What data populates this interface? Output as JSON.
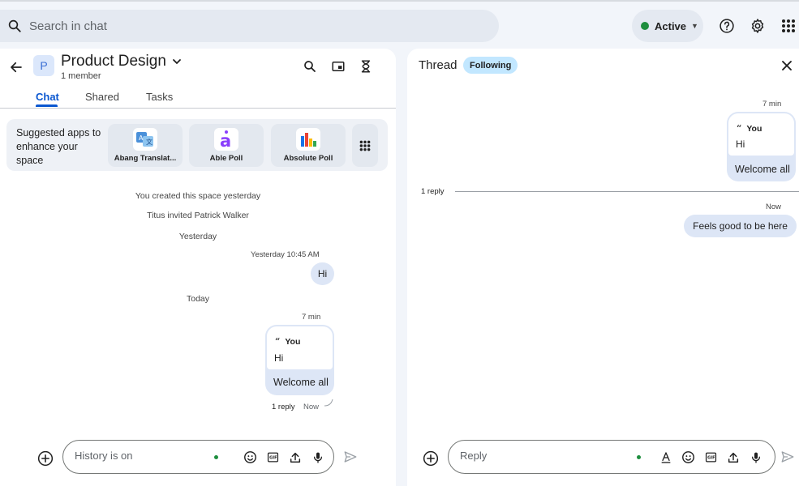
{
  "topbar": {
    "search_placeholder": "Search in chat",
    "status_label": "Active",
    "status_color": "#1e8e3e",
    "icons": [
      "search-icon",
      "help-icon",
      "gear-icon",
      "apps-grid-icon"
    ]
  },
  "space": {
    "avatar_letter": "P",
    "title": "Product Design",
    "members": "1 member"
  },
  "tabs": [
    {
      "label": "Chat",
      "active": true
    },
    {
      "label": "Shared",
      "active": false
    },
    {
      "label": "Tasks",
      "active": false
    }
  ],
  "suggested_apps": {
    "text": "Suggested apps to enhance your space",
    "apps": [
      {
        "name": "Abang Translat..."
      },
      {
        "name": "Able Poll"
      },
      {
        "name": "Absolute Poll"
      }
    ]
  },
  "chat": {
    "sys_created": "You created this space yesterday",
    "sys_invited": "Titus invited Patrick Walker",
    "day_yesterday": "Yesterday",
    "msg1_time": "Yesterday 10:45 AM",
    "msg1_text": "Hi",
    "day_today": "Today",
    "msg2_time": "7 min",
    "msg2_quote_author": "You",
    "msg2_quote_text": "Hi",
    "msg2_text": "Welcome all",
    "msg2_replies": "1 reply",
    "msg2_reply_time": "Now"
  },
  "composer_left": {
    "placeholder": "History is on"
  },
  "thread": {
    "title": "Thread",
    "following_label": "Following",
    "msg_time": "7 min",
    "quote_author": "You",
    "quote_text": "Hi",
    "msg_text": "Welcome all",
    "reply_count": "1 reply",
    "reply_time": "Now",
    "reply_text": "Feels good to be here"
  },
  "composer_right": {
    "placeholder": "Reply"
  }
}
